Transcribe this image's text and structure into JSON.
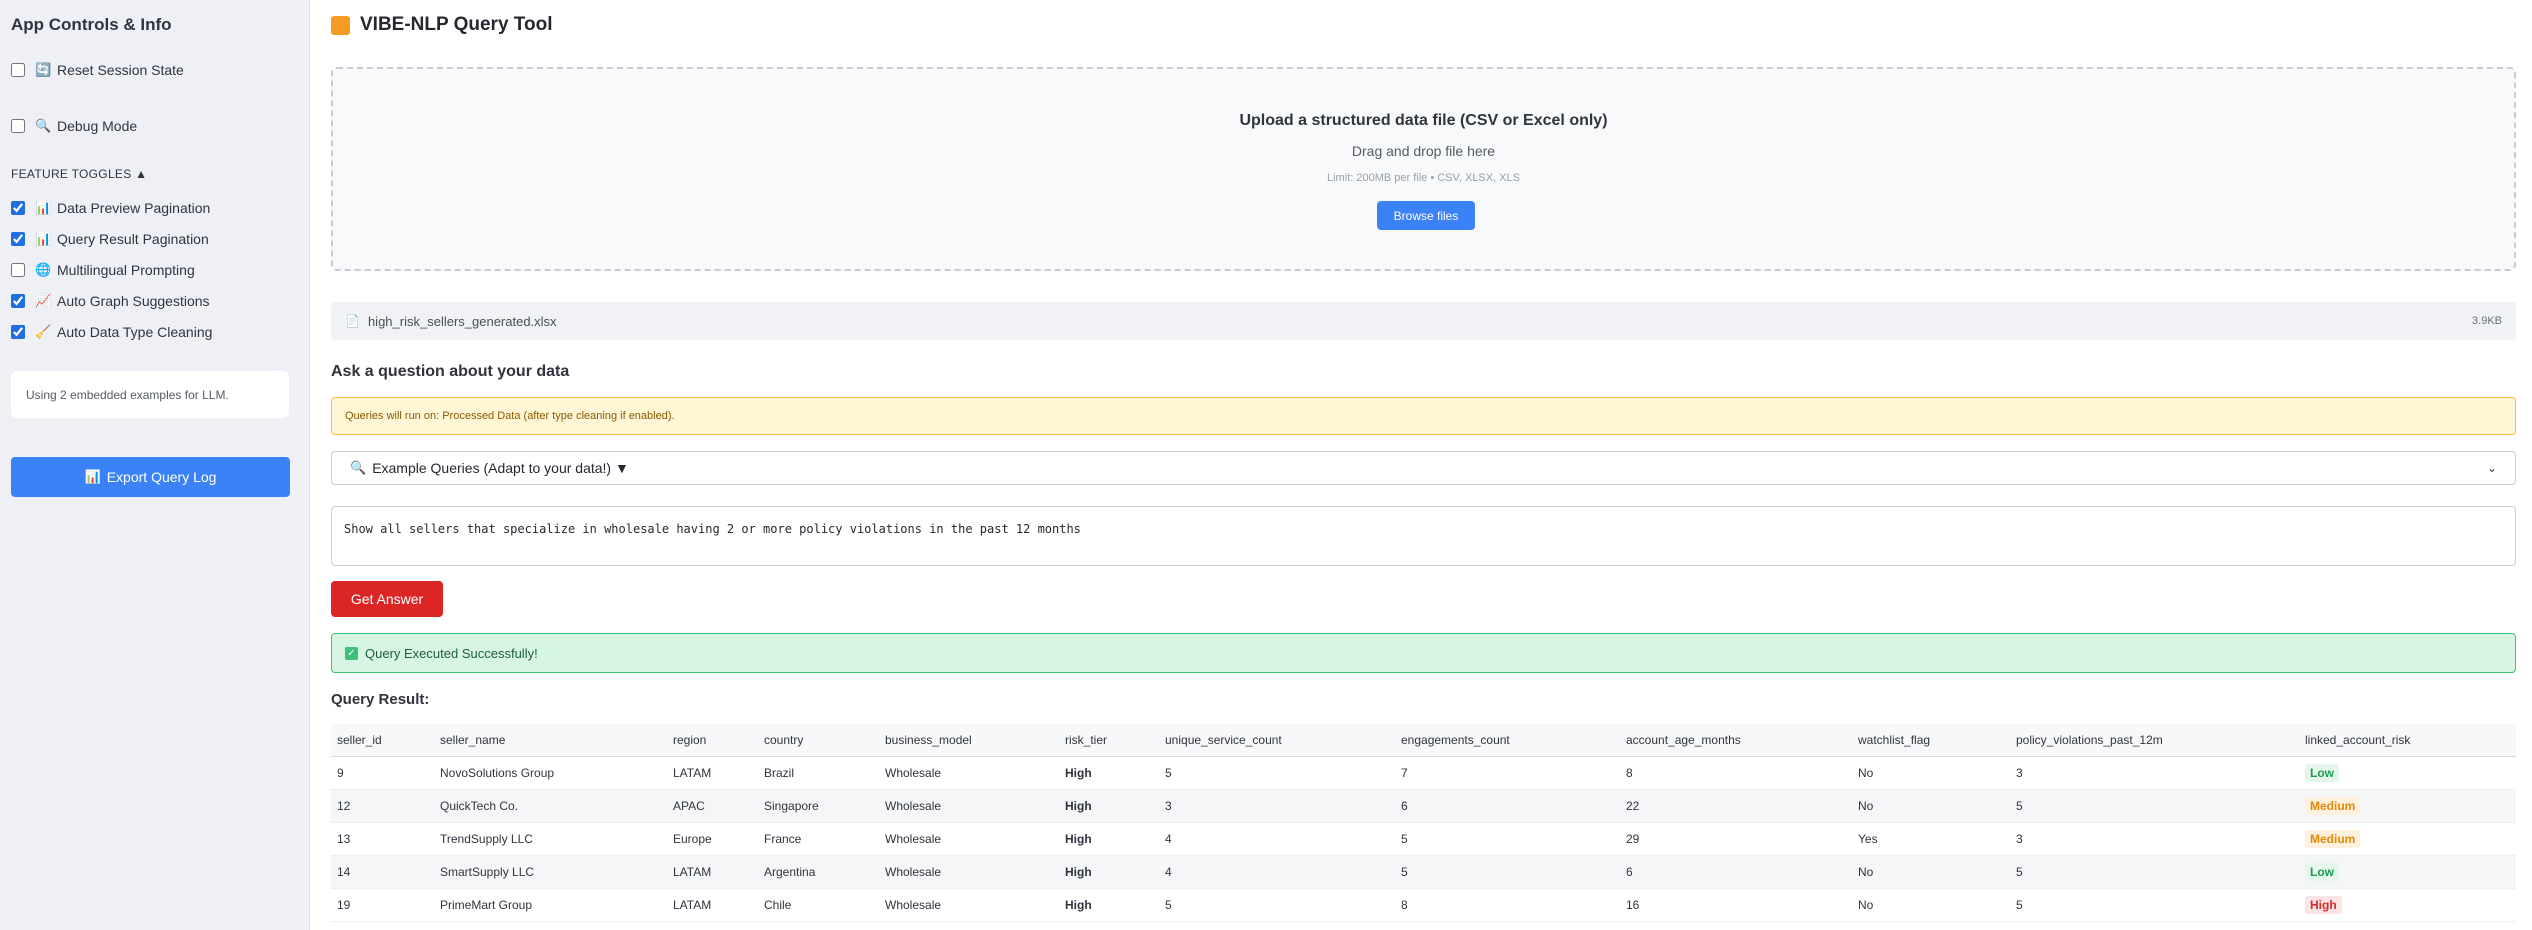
{
  "sidebar": {
    "title": "App Controls & Info",
    "controls": [
      {
        "label": "Reset Session State",
        "checked": false,
        "icon": "🔄"
      },
      {
        "label": "Debug Mode",
        "checked": false,
        "icon": "🔍"
      }
    ],
    "section_label": "FEATURE TOGGLES ▲",
    "toggles": [
      {
        "label": "Data Preview Pagination",
        "checked": true,
        "icon": "📊"
      },
      {
        "label": "Query Result Pagination",
        "checked": true,
        "icon": "📊"
      },
      {
        "label": "Multilingual Prompting",
        "checked": false,
        "icon": "🌐"
      },
      {
        "label": "Auto Graph Suggestions",
        "checked": true,
        "icon": "📈"
      },
      {
        "label": "Auto Data Type Cleaning",
        "checked": true,
        "icon": "🧹"
      }
    ],
    "info_text": "Using 2 embedded examples for LLM.",
    "export_icon": "📊",
    "export_label": "Export Query Log"
  },
  "app": {
    "title": "VIBE-NLP Query Tool",
    "logo_color": "#f59b23"
  },
  "upload": {
    "title": "Upload a structured data file (CSV or Excel only)",
    "drag_text": "Drag and drop file here",
    "limit_text": "Limit: 200MB per file • CSV, XLSX, XLS",
    "browse_label": "Browse files",
    "file_name": "high_risk_sellers_generated.xlsx",
    "file_size": "3.9KB"
  },
  "ask": {
    "heading": "Ask a question about your data",
    "warning": "Queries will run on: Processed Data (after type cleaning if enabled).",
    "examples_icon": "🔍",
    "examples_label": "Example Queries (Adapt to your data!) ▼",
    "query_text": "Show all sellers that specialize in wholesale having 2 or more policy violations in the past 12 months",
    "submit_label": "Get Answer",
    "success_text": "Query Executed Successfully!"
  },
  "result": {
    "heading": "Query Result:",
    "columns": [
      "seller_id",
      "seller_name",
      "region",
      "country",
      "business_model",
      "risk_tier",
      "unique_service_count",
      "engagements_count",
      "account_age_months",
      "watchlist_flag",
      "policy_violations_past_12m",
      "linked_account_risk"
    ],
    "rows": [
      [
        "9",
        "NovoSolutions Group",
        "LATAM",
        "Brazil",
        "Wholesale",
        "High",
        "5",
        "7",
        "8",
        "No",
        "3",
        "Low"
      ],
      [
        "12",
        "QuickTech Co.",
        "APAC",
        "Singapore",
        "Wholesale",
        "High",
        "3",
        "6",
        "22",
        "No",
        "5",
        "Medium"
      ],
      [
        "13",
        "TrendSupply LLC",
        "Europe",
        "France",
        "Wholesale",
        "High",
        "4",
        "5",
        "29",
        "Yes",
        "3",
        "Medium"
      ],
      [
        "14",
        "SmartSupply LLC",
        "LATAM",
        "Argentina",
        "Wholesale",
        "High",
        "4",
        "5",
        "6",
        "No",
        "5",
        "Low"
      ],
      [
        "19",
        "PrimeMart Group",
        "LATAM",
        "Chile",
        "Wholesale",
        "High",
        "5",
        "8",
        "16",
        "No",
        "5",
        "High"
      ]
    ]
  },
  "colors": {
    "accent_blue": "#3b82f6",
    "danger_red": "#dc2626",
    "success_green": "#3fbf7a",
    "warning_yellow": "#f3c14b"
  }
}
